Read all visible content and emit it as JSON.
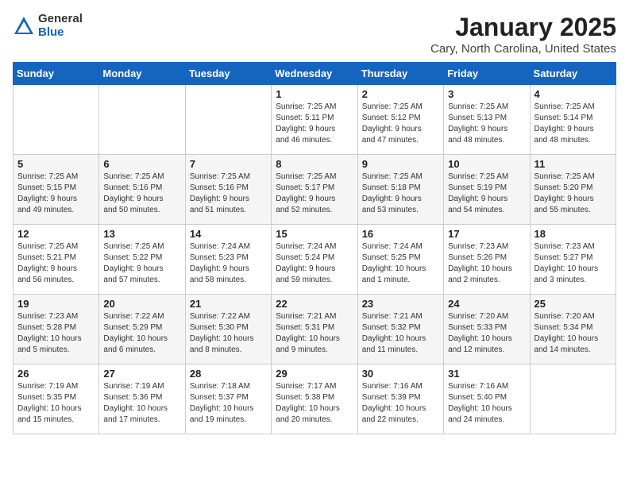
{
  "logo": {
    "general": "General",
    "blue": "Blue"
  },
  "title": "January 2025",
  "subtitle": "Cary, North Carolina, United States",
  "weekdays": [
    "Sunday",
    "Monday",
    "Tuesday",
    "Wednesday",
    "Thursday",
    "Friday",
    "Saturday"
  ],
  "weeks": [
    [
      {
        "num": "",
        "info": ""
      },
      {
        "num": "",
        "info": ""
      },
      {
        "num": "",
        "info": ""
      },
      {
        "num": "1",
        "info": "Sunrise: 7:25 AM\nSunset: 5:11 PM\nDaylight: 9 hours\nand 46 minutes."
      },
      {
        "num": "2",
        "info": "Sunrise: 7:25 AM\nSunset: 5:12 PM\nDaylight: 9 hours\nand 47 minutes."
      },
      {
        "num": "3",
        "info": "Sunrise: 7:25 AM\nSunset: 5:13 PM\nDaylight: 9 hours\nand 48 minutes."
      },
      {
        "num": "4",
        "info": "Sunrise: 7:25 AM\nSunset: 5:14 PM\nDaylight: 9 hours\nand 48 minutes."
      }
    ],
    [
      {
        "num": "5",
        "info": "Sunrise: 7:25 AM\nSunset: 5:15 PM\nDaylight: 9 hours\nand 49 minutes."
      },
      {
        "num": "6",
        "info": "Sunrise: 7:25 AM\nSunset: 5:16 PM\nDaylight: 9 hours\nand 50 minutes."
      },
      {
        "num": "7",
        "info": "Sunrise: 7:25 AM\nSunset: 5:16 PM\nDaylight: 9 hours\nand 51 minutes."
      },
      {
        "num": "8",
        "info": "Sunrise: 7:25 AM\nSunset: 5:17 PM\nDaylight: 9 hours\nand 52 minutes."
      },
      {
        "num": "9",
        "info": "Sunrise: 7:25 AM\nSunset: 5:18 PM\nDaylight: 9 hours\nand 53 minutes."
      },
      {
        "num": "10",
        "info": "Sunrise: 7:25 AM\nSunset: 5:19 PM\nDaylight: 9 hours\nand 54 minutes."
      },
      {
        "num": "11",
        "info": "Sunrise: 7:25 AM\nSunset: 5:20 PM\nDaylight: 9 hours\nand 55 minutes."
      }
    ],
    [
      {
        "num": "12",
        "info": "Sunrise: 7:25 AM\nSunset: 5:21 PM\nDaylight: 9 hours\nand 56 minutes."
      },
      {
        "num": "13",
        "info": "Sunrise: 7:25 AM\nSunset: 5:22 PM\nDaylight: 9 hours\nand 57 minutes."
      },
      {
        "num": "14",
        "info": "Sunrise: 7:24 AM\nSunset: 5:23 PM\nDaylight: 9 hours\nand 58 minutes."
      },
      {
        "num": "15",
        "info": "Sunrise: 7:24 AM\nSunset: 5:24 PM\nDaylight: 9 hours\nand 59 minutes."
      },
      {
        "num": "16",
        "info": "Sunrise: 7:24 AM\nSunset: 5:25 PM\nDaylight: 10 hours\nand 1 minute."
      },
      {
        "num": "17",
        "info": "Sunrise: 7:23 AM\nSunset: 5:26 PM\nDaylight: 10 hours\nand 2 minutes."
      },
      {
        "num": "18",
        "info": "Sunrise: 7:23 AM\nSunset: 5:27 PM\nDaylight: 10 hours\nand 3 minutes."
      }
    ],
    [
      {
        "num": "19",
        "info": "Sunrise: 7:23 AM\nSunset: 5:28 PM\nDaylight: 10 hours\nand 5 minutes."
      },
      {
        "num": "20",
        "info": "Sunrise: 7:22 AM\nSunset: 5:29 PM\nDaylight: 10 hours\nand 6 minutes."
      },
      {
        "num": "21",
        "info": "Sunrise: 7:22 AM\nSunset: 5:30 PM\nDaylight: 10 hours\nand 8 minutes."
      },
      {
        "num": "22",
        "info": "Sunrise: 7:21 AM\nSunset: 5:31 PM\nDaylight: 10 hours\nand 9 minutes."
      },
      {
        "num": "23",
        "info": "Sunrise: 7:21 AM\nSunset: 5:32 PM\nDaylight: 10 hours\nand 11 minutes."
      },
      {
        "num": "24",
        "info": "Sunrise: 7:20 AM\nSunset: 5:33 PM\nDaylight: 10 hours\nand 12 minutes."
      },
      {
        "num": "25",
        "info": "Sunrise: 7:20 AM\nSunset: 5:34 PM\nDaylight: 10 hours\nand 14 minutes."
      }
    ],
    [
      {
        "num": "26",
        "info": "Sunrise: 7:19 AM\nSunset: 5:35 PM\nDaylight: 10 hours\nand 15 minutes."
      },
      {
        "num": "27",
        "info": "Sunrise: 7:19 AM\nSunset: 5:36 PM\nDaylight: 10 hours\nand 17 minutes."
      },
      {
        "num": "28",
        "info": "Sunrise: 7:18 AM\nSunset: 5:37 PM\nDaylight: 10 hours\nand 19 minutes."
      },
      {
        "num": "29",
        "info": "Sunrise: 7:17 AM\nSunset: 5:38 PM\nDaylight: 10 hours\nand 20 minutes."
      },
      {
        "num": "30",
        "info": "Sunrise: 7:16 AM\nSunset: 5:39 PM\nDaylight: 10 hours\nand 22 minutes."
      },
      {
        "num": "31",
        "info": "Sunrise: 7:16 AM\nSunset: 5:40 PM\nDaylight: 10 hours\nand 24 minutes."
      },
      {
        "num": "",
        "info": ""
      }
    ]
  ]
}
